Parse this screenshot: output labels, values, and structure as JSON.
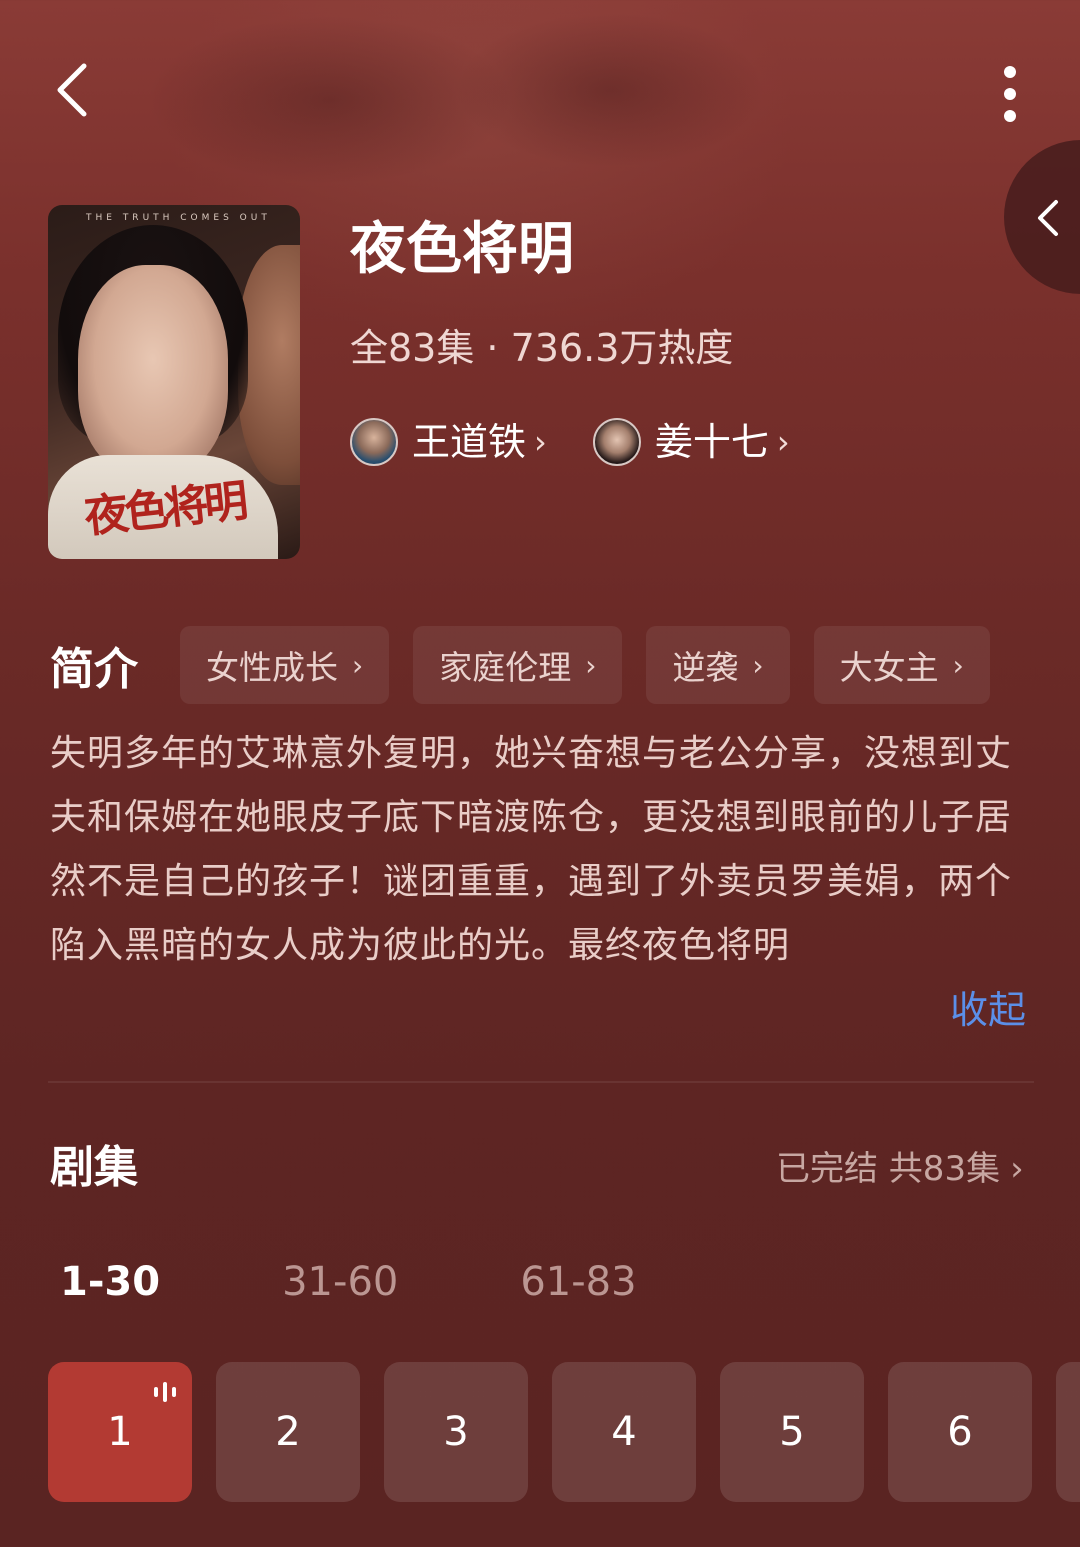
{
  "header": {
    "back_icon": "chevron-left-icon",
    "more_icon": "more-vertical-icon",
    "side_icon": "chevron-left-icon"
  },
  "poster": {
    "top_text": "THE TRUTH COMES OUT",
    "title_art": "夜色将明"
  },
  "drama": {
    "title": "夜色将明",
    "meta": "全83集 · 736.3万热度",
    "cast": [
      {
        "name": "王道铁",
        "chevron": "›"
      },
      {
        "name": "姜十七",
        "chevron": "›"
      }
    ]
  },
  "intro": {
    "label": "简介",
    "tags": [
      {
        "label": "女性成长",
        "chevron": "›"
      },
      {
        "label": "家庭伦理",
        "chevron": "›"
      },
      {
        "label": "逆袭",
        "chevron": "›"
      },
      {
        "label": "大女主",
        "chevron": "›"
      }
    ],
    "synopsis": "失明多年的艾琳意外复明，她兴奋想与老公分享，没想到丈夫和保姆在她眼皮子底下暗渡陈仓，更没想到眼前的儿子居然不是自己的孩子！谜团重重，遇到了外卖员罗美娟，两个陷入黑暗的女人成为彼此的光。最终夜色将明",
    "collapse_label": "收起"
  },
  "episodes": {
    "title": "剧集",
    "status": "已完结 共83集",
    "status_chevron": "›",
    "ranges": [
      "1-30",
      "31-60",
      "61-83"
    ],
    "active_range": "1-30",
    "items": [
      "1",
      "2",
      "3",
      "4",
      "5",
      "6"
    ],
    "playing": "1"
  },
  "colors": {
    "accent": "#b33a33",
    "link": "#5b8fe8",
    "background": "#6b2a27"
  }
}
